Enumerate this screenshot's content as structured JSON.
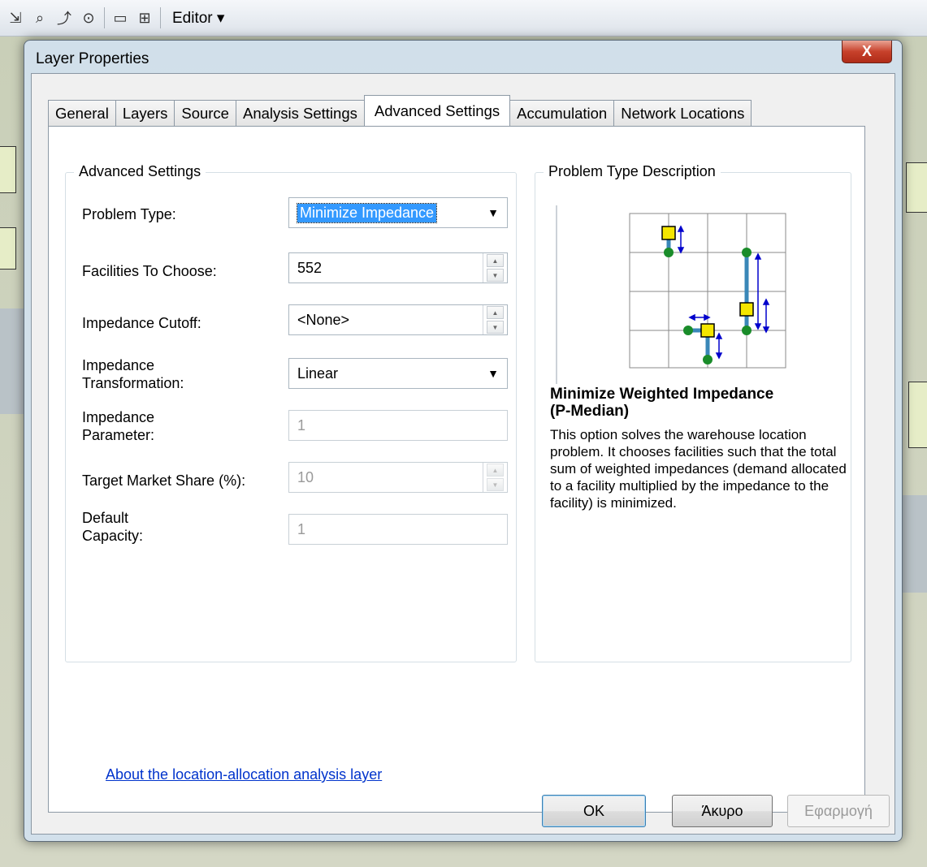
{
  "app": {
    "toolbar": {
      "editor_menu": "Editor ▾"
    }
  },
  "dialog": {
    "title": "Layer Properties",
    "close_symbol": "X",
    "tabs": [
      {
        "label": "General",
        "active": false
      },
      {
        "label": "Layers",
        "active": false
      },
      {
        "label": "Source",
        "active": false
      },
      {
        "label": "Analysis Settings",
        "active": false
      },
      {
        "label": "Advanced Settings",
        "active": true
      },
      {
        "label": "Accumulation",
        "active": false
      },
      {
        "label": "Network Locations",
        "active": false
      }
    ],
    "advanced": {
      "group_title": "Advanced Settings",
      "problem_type": {
        "label": "Problem Type:",
        "value": "Minimize Impedance"
      },
      "facilities_to_choose": {
        "label": "Facilities To Choose:",
        "value": "552"
      },
      "impedance_cutoff": {
        "label": "Impedance Cutoff:",
        "value": "<None>"
      },
      "impedance_transformation": {
        "label_line1": "Impedance",
        "label_line2": "Transformation:",
        "value": "Linear"
      },
      "impedance_parameter": {
        "label_line1": "Impedance",
        "label_line2": "Parameter:",
        "value": "1"
      },
      "target_market_share": {
        "label": "Target Market Share (%):",
        "value": "10"
      },
      "default_capacity": {
        "label_line1": "Default",
        "label_line2": "Capacity:",
        "value": "1"
      }
    },
    "description": {
      "group_title": "Problem Type Description",
      "title_line1": "Minimize Weighted Impedance",
      "title_line2": "(P-Median)",
      "body": "This option solves the warehouse location problem. It chooses facilities such that the total sum of weighted impedances (demand allocated to a facility multiplied by the impedance to the facility) is minimized."
    },
    "about_link": "About the location-allocation analysis layer",
    "buttons": {
      "ok": "OK",
      "cancel": "Άκυρο",
      "apply": "Εφαρμογή"
    },
    "colors": {
      "facility": "#f5e600",
      "demand": "#1a8c2a",
      "allocation_line": "#3a87b8",
      "arrow": "#0000cc",
      "grid": "#8a8a8a"
    }
  }
}
